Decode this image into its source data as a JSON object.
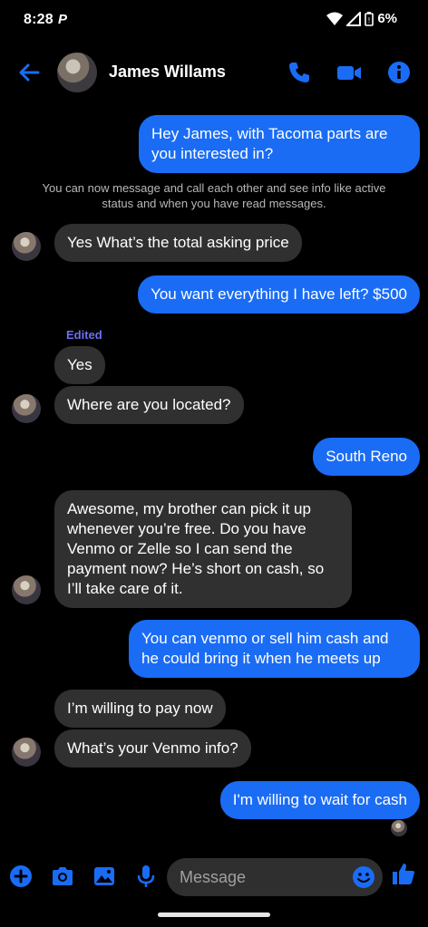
{
  "status": {
    "time": "8:28",
    "carrier_icon": "paypal-p-icon",
    "battery": "6%"
  },
  "header": {
    "contact_name": "James Willams"
  },
  "colors": {
    "accent": "#1a6cf5",
    "incoming_bubble": "#303030",
    "edited": "#6e6ef5"
  },
  "messages": [
    {
      "dir": "out",
      "text": "Hey James, with Tacoma parts are you interested in?"
    },
    {
      "dir": "info",
      "text": "You can now message and call each other and see info like active status and when you have read messages."
    },
    {
      "dir": "in",
      "text": "Yes What’s the total asking price"
    },
    {
      "dir": "out",
      "text": "You want everything I have left? $500"
    },
    {
      "dir": "edited_label",
      "text": "Edited"
    },
    {
      "dir": "in",
      "text": "Yes"
    },
    {
      "dir": "in",
      "text": "Where are you located?"
    },
    {
      "dir": "out",
      "text": "South Reno"
    },
    {
      "dir": "in",
      "text": "Awesome, my brother can pick it up whenever you’re free. Do you have Venmo or Zelle so I can send the payment now? He’s short on cash, so I’ll take care of it."
    },
    {
      "dir": "out",
      "text": "You can venmo or sell him cash and he could bring it when he meets up"
    },
    {
      "dir": "in",
      "text": "I’m willing to pay now"
    },
    {
      "dir": "in",
      "text": "What’s your Venmo info?"
    },
    {
      "dir": "out",
      "text": "I'm willing to wait for cash"
    }
  ],
  "composer": {
    "placeholder": "Message"
  }
}
